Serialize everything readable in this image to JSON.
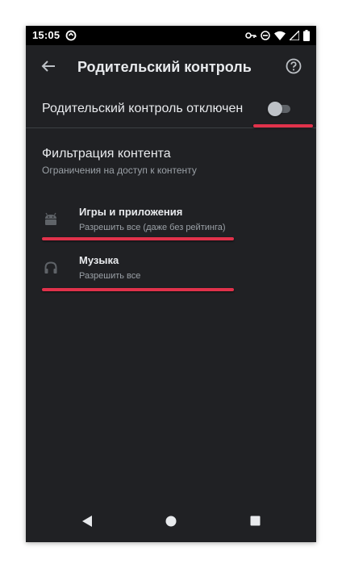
{
  "status_bar": {
    "time": "15:05",
    "icons": [
      "app-notification-icon",
      "vpn-key-icon",
      "do-not-disturb-icon",
      "wifi-icon",
      "cell-signal-icon",
      "battery-icon"
    ]
  },
  "toolbar": {
    "title": "Родительский контроль",
    "back_icon": "arrow-back-icon",
    "help_icon": "help-icon"
  },
  "master_toggle": {
    "label": "Родительский контроль отключен",
    "enabled": false
  },
  "content_filtering": {
    "title": "Фильтрация контента",
    "subtitle": "Ограничения на доступ к контенту",
    "items": [
      {
        "title": "Игры и приложения",
        "subtitle": "Разрешить все (даже без рейтинга)",
        "icon": "android-icon"
      },
      {
        "title": "Музыка",
        "subtitle": "Разрешить все",
        "icon": "headphones-icon"
      }
    ]
  },
  "nav_bar": {
    "buttons": [
      "back-icon",
      "home-icon",
      "recents-icon"
    ]
  },
  "colors": {
    "background": "#202124",
    "status_bar": "#000000",
    "primary_text": "#e8eaed",
    "secondary_text": "#9aa0a6",
    "annotation": "#e0324b"
  }
}
